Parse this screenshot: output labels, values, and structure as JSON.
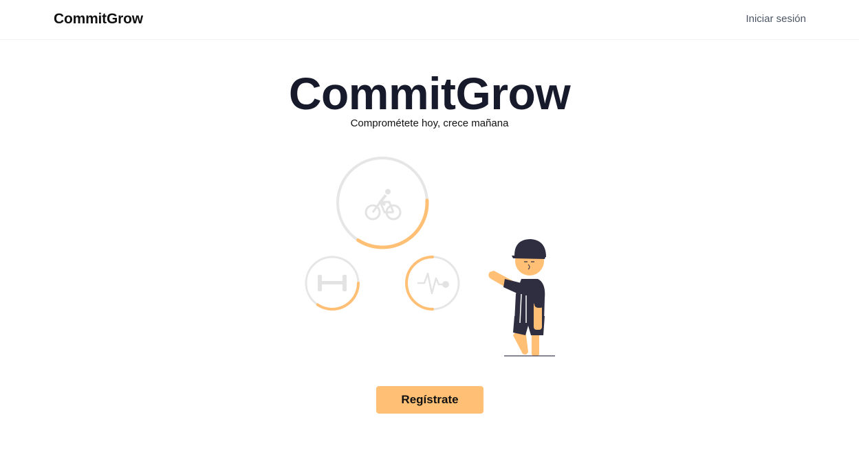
{
  "header": {
    "brand": "CommitGrow",
    "login_label": "Iniciar sesión"
  },
  "hero": {
    "title": "CommitGrow",
    "subtitle": "Comprométete hoy, crece mañana"
  },
  "illustration": {
    "icons": [
      "bicycle-icon",
      "dumbbell-icon",
      "heartbeat-icon"
    ],
    "progress": {
      "cycling": 0.35,
      "strength": 0.4,
      "health": 0.5
    },
    "colors": {
      "accent": "#ffbf75",
      "track": "#e6e6e6",
      "figure_dark": "#2f2e41",
      "skin": "#ffbf75"
    }
  },
  "cta": {
    "label": "Regístrate"
  }
}
